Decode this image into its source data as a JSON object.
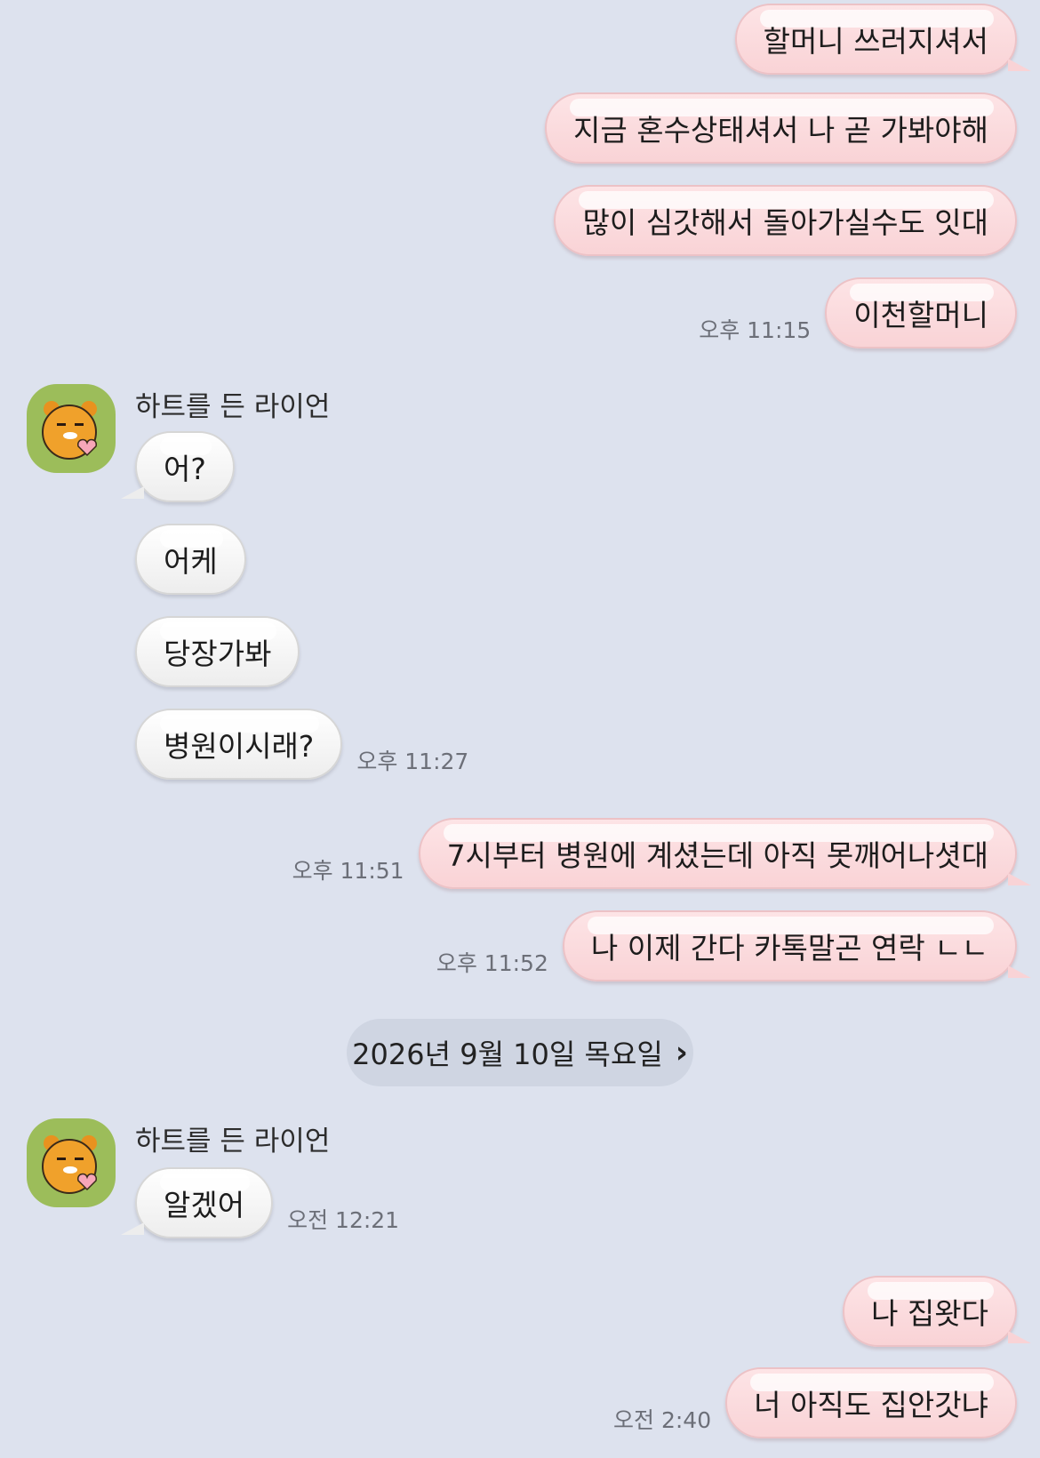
{
  "contact": {
    "name": "하트를 든 라이언"
  },
  "date_divider": {
    "label": "2026년 9월 10일 목요일",
    "chevron": "chevron-right-icon"
  },
  "messages": [
    {
      "text": "할머니 쓰러지셔서",
      "direction": "out"
    },
    {
      "text": "지금 혼수상태셔서 나 곧 가봐야해",
      "direction": "out"
    },
    {
      "text": "많이 심갓해서 돌아가실수도 잇대",
      "direction": "out"
    },
    {
      "text": "이천할머니",
      "direction": "out",
      "time": "오후 11:15"
    },
    {
      "text": "어?",
      "direction": "in"
    },
    {
      "text": "어케",
      "direction": "in"
    },
    {
      "text": "당장가봐",
      "direction": "in"
    },
    {
      "text": "병원이시래?",
      "direction": "in",
      "time": "오후 11:27"
    },
    {
      "text": "7시부터 병원에 계셨는데 아직 못깨어나셧대",
      "direction": "out",
      "time": "오후 11:51"
    },
    {
      "text": "나 이제 간다 카톡말곤 연락 ㄴㄴ",
      "direction": "out",
      "time": "오후 11:52"
    },
    {
      "text": "알겠어",
      "direction": "in",
      "time": "오전 12:21"
    },
    {
      "text": "나 집왓다",
      "direction": "out"
    },
    {
      "text": "너 아직도 집안갓냐",
      "direction": "out",
      "time": "오전 2:40"
    }
  ],
  "colors": {
    "background": "#dde2ee",
    "outgoing_bubble": "#fde4e6",
    "incoming_bubble": "#ffffff",
    "avatar_bg": "#9cbd5a"
  }
}
